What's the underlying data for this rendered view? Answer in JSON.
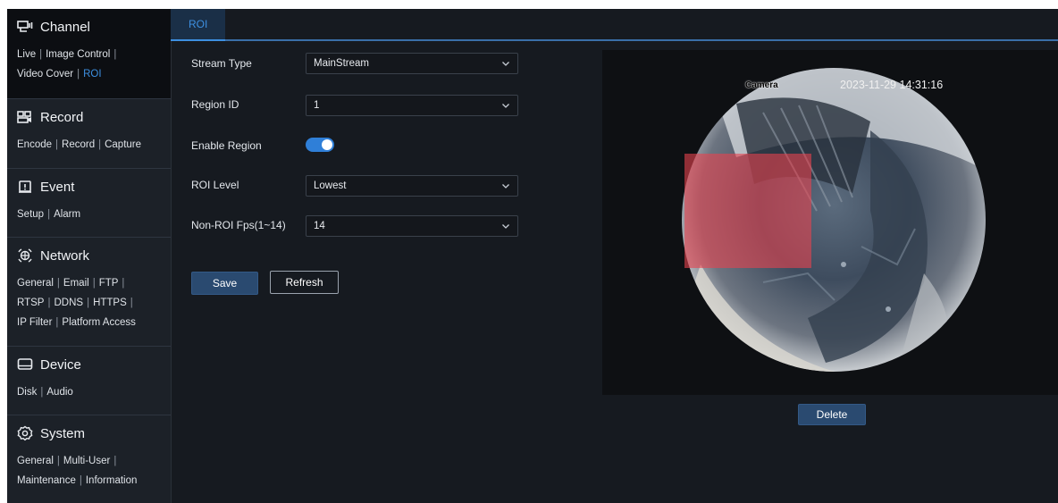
{
  "sidebar": {
    "sections": [
      {
        "id": "channel",
        "title": "Channel",
        "icon": "channel-icon",
        "links": [
          "Live",
          "Image Control",
          "Video Cover",
          "ROI"
        ],
        "active_link": "ROI"
      },
      {
        "id": "record",
        "title": "Record",
        "icon": "record-icon",
        "links": [
          "Encode",
          "Record",
          "Capture"
        ]
      },
      {
        "id": "event",
        "title": "Event",
        "icon": "event-icon",
        "links": [
          "Setup",
          "Alarm"
        ]
      },
      {
        "id": "network",
        "title": "Network",
        "icon": "network-icon",
        "links": [
          "General",
          "Email",
          "FTP",
          "RTSP",
          "DDNS",
          "HTTPS",
          "IP Filter",
          "Platform Access"
        ]
      },
      {
        "id": "device",
        "title": "Device",
        "icon": "device-icon",
        "links": [
          "Disk",
          "Audio"
        ]
      },
      {
        "id": "system",
        "title": "System",
        "icon": "system-icon",
        "links": [
          "General",
          "Multi-User",
          "Maintenance",
          "Information"
        ]
      }
    ]
  },
  "tabs": [
    "ROI"
  ],
  "form": {
    "stream_type": {
      "label": "Stream Type",
      "value": "MainStream"
    },
    "region_id": {
      "label": "Region ID",
      "value": "1"
    },
    "enable_region": {
      "label": "Enable Region",
      "value": true
    },
    "roi_level": {
      "label": "ROI Level",
      "value": "Lowest"
    },
    "non_roi_fps": {
      "label": "Non-ROI Fps(1~14)",
      "value": "14"
    },
    "save_label": "Save",
    "refresh_label": "Refresh"
  },
  "preview": {
    "camera_name": "Camera",
    "timestamp": "2023-11-29 14:31:16",
    "delete_label": "Delete"
  },
  "colors": {
    "accent": "#3d8fe0",
    "roi_region": "#e8434f",
    "toggle_on": "#2f7fd8"
  }
}
